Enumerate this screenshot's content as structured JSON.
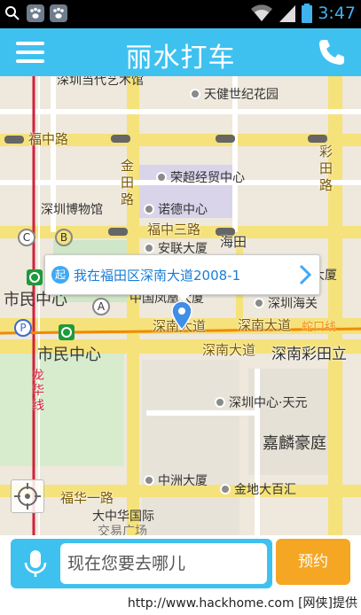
{
  "status_bar": {
    "time": "3:47",
    "left_icons": [
      "search-icon",
      "paw-icon",
      "paw-icon"
    ],
    "right_icons": [
      "wifi-icon",
      "signal-icon",
      "battery-icon"
    ]
  },
  "header": {
    "title": "丽水打车"
  },
  "map": {
    "road_labels": [
      "福中路",
      "福中三路",
      "深南大道",
      "深南大道",
      "深南大道",
      "深南彩田立",
      "福华一路",
      "金田路",
      "彩田路",
      "海田"
    ],
    "places": [
      "深圳当代艺术馆",
      "天健世纪花园",
      "荣超经贸中心",
      "诺德中心",
      "深圳博物馆",
      "安联大厦",
      "大厦",
      "中国凤凰大厦",
      "深圳海关",
      "深圳中心·天元",
      "嘉麟豪庭",
      "中洲大厦",
      "金地大百汇",
      "大中华国际",
      "交易广场"
    ],
    "districts": [
      "市民中心",
      "市民中心"
    ],
    "metro_lines": [
      "龙华线",
      "蛇口线"
    ],
    "metro_markers": [
      "C",
      "B",
      "A",
      "P"
    ],
    "callout": {
      "badge": "起",
      "text": "我在福田区深南大道2008-1"
    }
  },
  "bottom": {
    "input_placeholder": "现在您要去哪儿",
    "book_label": "预约"
  },
  "watermark": "http://www.hackhome.com [网侠]提供",
  "colors": {
    "accent": "#3fc1f0",
    "book_button": "#f5a623",
    "callout_text": "#1a7dd6"
  }
}
